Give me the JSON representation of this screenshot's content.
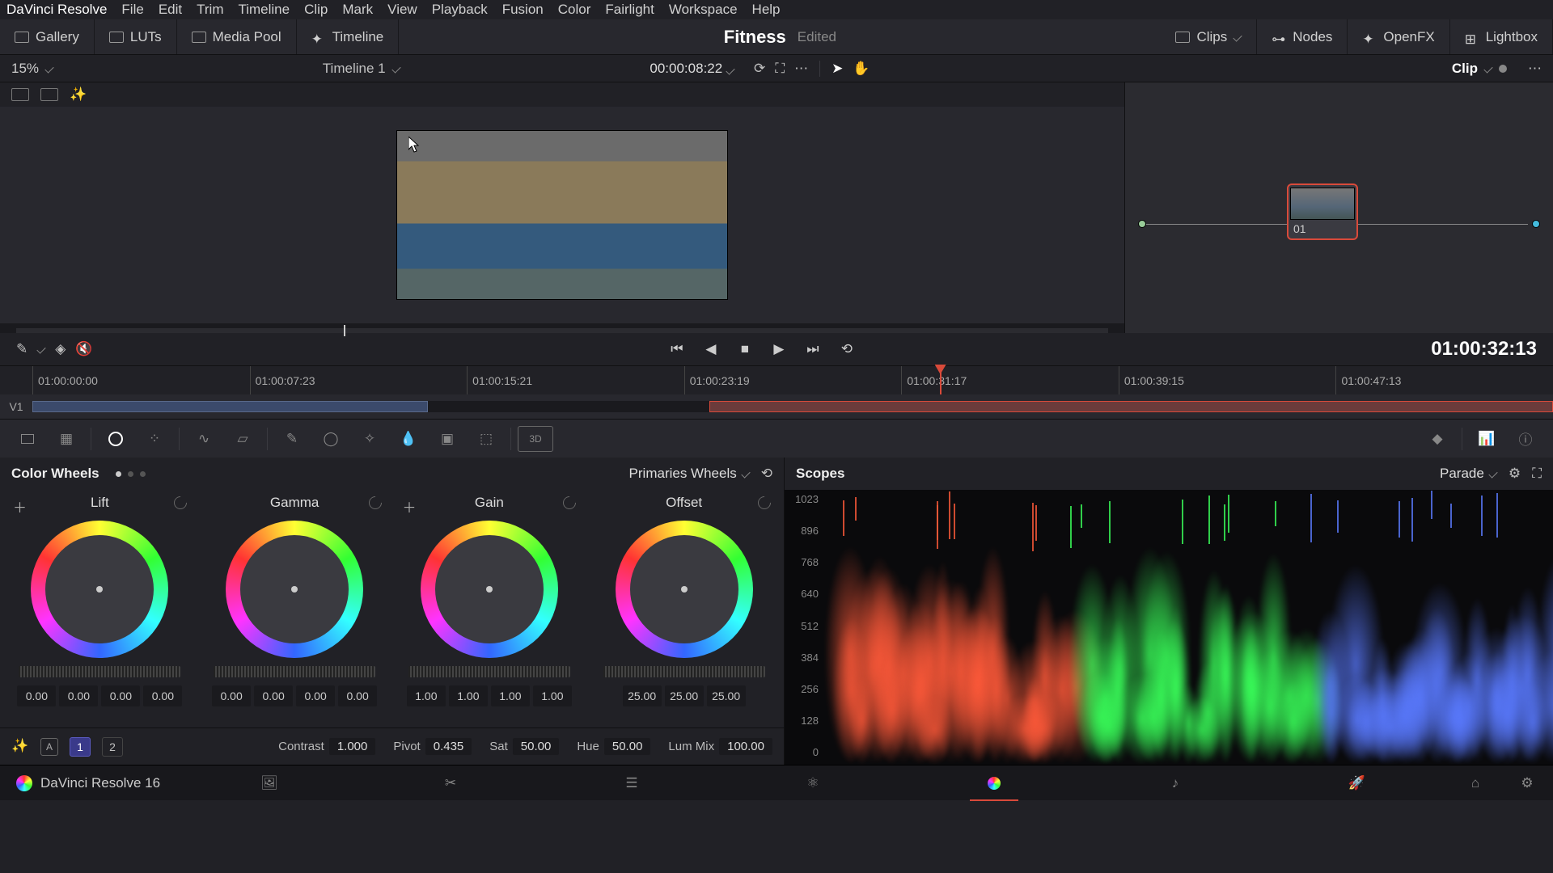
{
  "menu": {
    "brand": "DaVinci Resolve",
    "items": [
      "File",
      "Edit",
      "Trim",
      "Timeline",
      "Clip",
      "Mark",
      "View",
      "Playback",
      "Fusion",
      "Color",
      "Fairlight",
      "Workspace",
      "Help"
    ]
  },
  "toolbar": {
    "gallery": "Gallery",
    "luts": "LUTs",
    "mediapool": "Media Pool",
    "timeline": "Timeline",
    "title": "Fitness",
    "subtitle": "Edited",
    "clips": "Clips",
    "nodes": "Nodes",
    "openfx": "OpenFX",
    "lightbox": "Lightbox"
  },
  "smallrow": {
    "zoom": "15%",
    "timeline_name": "Timeline 1",
    "tc": "00:00:08:22",
    "right_label": "Clip"
  },
  "node": {
    "label": "01"
  },
  "transport": {
    "tc": "01:00:32:13"
  },
  "ruler": {
    "ticks": [
      "01:00:00:00",
      "01:00:07:23",
      "01:00:15:21",
      "01:00:23:19",
      "01:00:31:17",
      "01:00:39:15",
      "01:00:47:13"
    ],
    "playhead_pct": 60.5
  },
  "track": {
    "label": "V1"
  },
  "wheels": {
    "title": "Color Wheels",
    "mode": "Primaries Wheels",
    "groups": [
      {
        "name": "Lift",
        "vals": [
          "0.00",
          "0.00",
          "0.00",
          "0.00"
        ]
      },
      {
        "name": "Gamma",
        "vals": [
          "0.00",
          "0.00",
          "0.00",
          "0.00"
        ]
      },
      {
        "name": "Gain",
        "vals": [
          "1.00",
          "1.00",
          "1.00",
          "1.00"
        ]
      },
      {
        "name": "Offset",
        "vals": [
          "25.00",
          "25.00",
          "25.00"
        ]
      }
    ]
  },
  "adj": {
    "tab_sel": "1",
    "tab_other": "2",
    "params": [
      {
        "lbl": "Contrast",
        "val": "1.000"
      },
      {
        "lbl": "Pivot",
        "val": "0.435"
      },
      {
        "lbl": "Sat",
        "val": "50.00"
      },
      {
        "lbl": "Hue",
        "val": "50.00"
      },
      {
        "lbl": "Lum Mix",
        "val": "100.00"
      }
    ]
  },
  "scopes": {
    "title": "Scopes",
    "mode": "Parade",
    "scale": [
      "1023",
      "896",
      "768",
      "640",
      "512",
      "384",
      "256",
      "128",
      "0"
    ]
  },
  "bottom": {
    "brand": "DaVinci Resolve 16"
  }
}
